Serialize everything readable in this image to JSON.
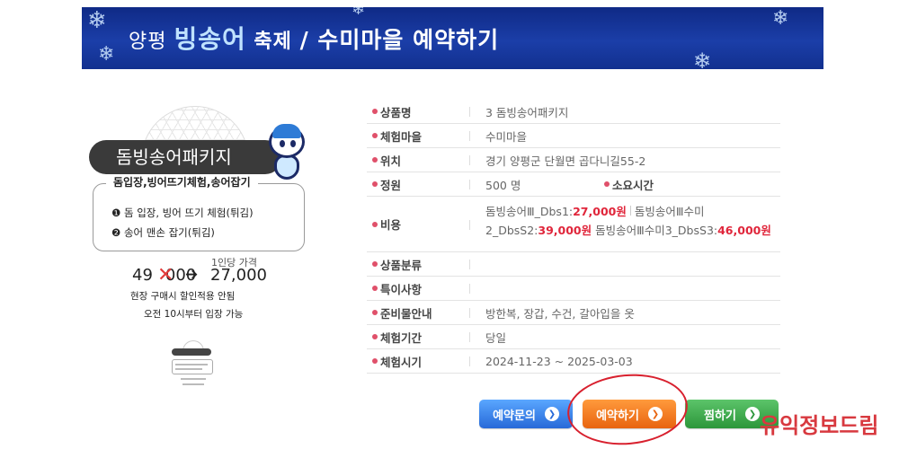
{
  "banner": {
    "part1": "양평 ",
    "part2": "빙송어",
    "part3": " 축제 ",
    "part4": "/ 수미마을 예약하기"
  },
  "product_card": {
    "name": "돔빙송어패키지",
    "subtitle": "돔입장,빙어뜨기체험,송어잡기",
    "items": [
      "❶ 돔 입장, 빙어 뜨기 체험(튀김)",
      "❷ 송어 맨손 잡기(튀김)"
    ],
    "price_note": "1인당 가격",
    "old_price_a": "49",
    "old_price_b": "000",
    "arrow": "➔",
    "new_price": "27,000",
    "note1": "현장 구매시 할인적용 안됨",
    "note2": "오전 10시부터 입장 가능"
  },
  "info": {
    "product_name": {
      "label": "상품명",
      "value": "3 돔빙송어패키지"
    },
    "village": {
      "label": "체험마을",
      "value": "수미마을"
    },
    "location": {
      "label": "위치",
      "value": "경기 양평군 단월면 곱다니길55-2"
    },
    "capacity": {
      "label": "정원",
      "value": "500 명",
      "label2": "소요시간"
    },
    "cost": {
      "label": "비용",
      "item1_name": "돔빙송어Ⅲ_Dbs1:",
      "item1_price": "27,000원",
      "item2_name": "돔빙송어Ⅲ수미2_DbsS2:",
      "item2_price": "39,000원",
      "item3_name": "돔빙송어Ⅲ수미3_DbsS3:",
      "item3_price": "46,000원"
    },
    "category": {
      "label": "상품분류",
      "value": ""
    },
    "special": {
      "label": "특이사항",
      "value": ""
    },
    "prep": {
      "label": "준비물안내",
      "value": "방한복, 장갑, 수건, 갈아입을 옷"
    },
    "period": {
      "label": "체험기간",
      "value": "당일"
    },
    "time": {
      "label": "체험시기",
      "value": "2024-11-23 ~ 2025-03-03"
    }
  },
  "buttons": {
    "inquiry": "예약문의",
    "reserve": "예약하기",
    "wish": "찜하기",
    "arrow": "❯"
  },
  "watermark": "유익정보드림",
  "colors": {
    "banner_bg": "#1b3ea8",
    "accent_dot": "#e0506a",
    "price_red": "#e0263b",
    "btn_blue": "#2769d8",
    "btn_orange": "#e86410",
    "btn_green": "#2c963a",
    "highlight_circle": "#d8202e"
  }
}
